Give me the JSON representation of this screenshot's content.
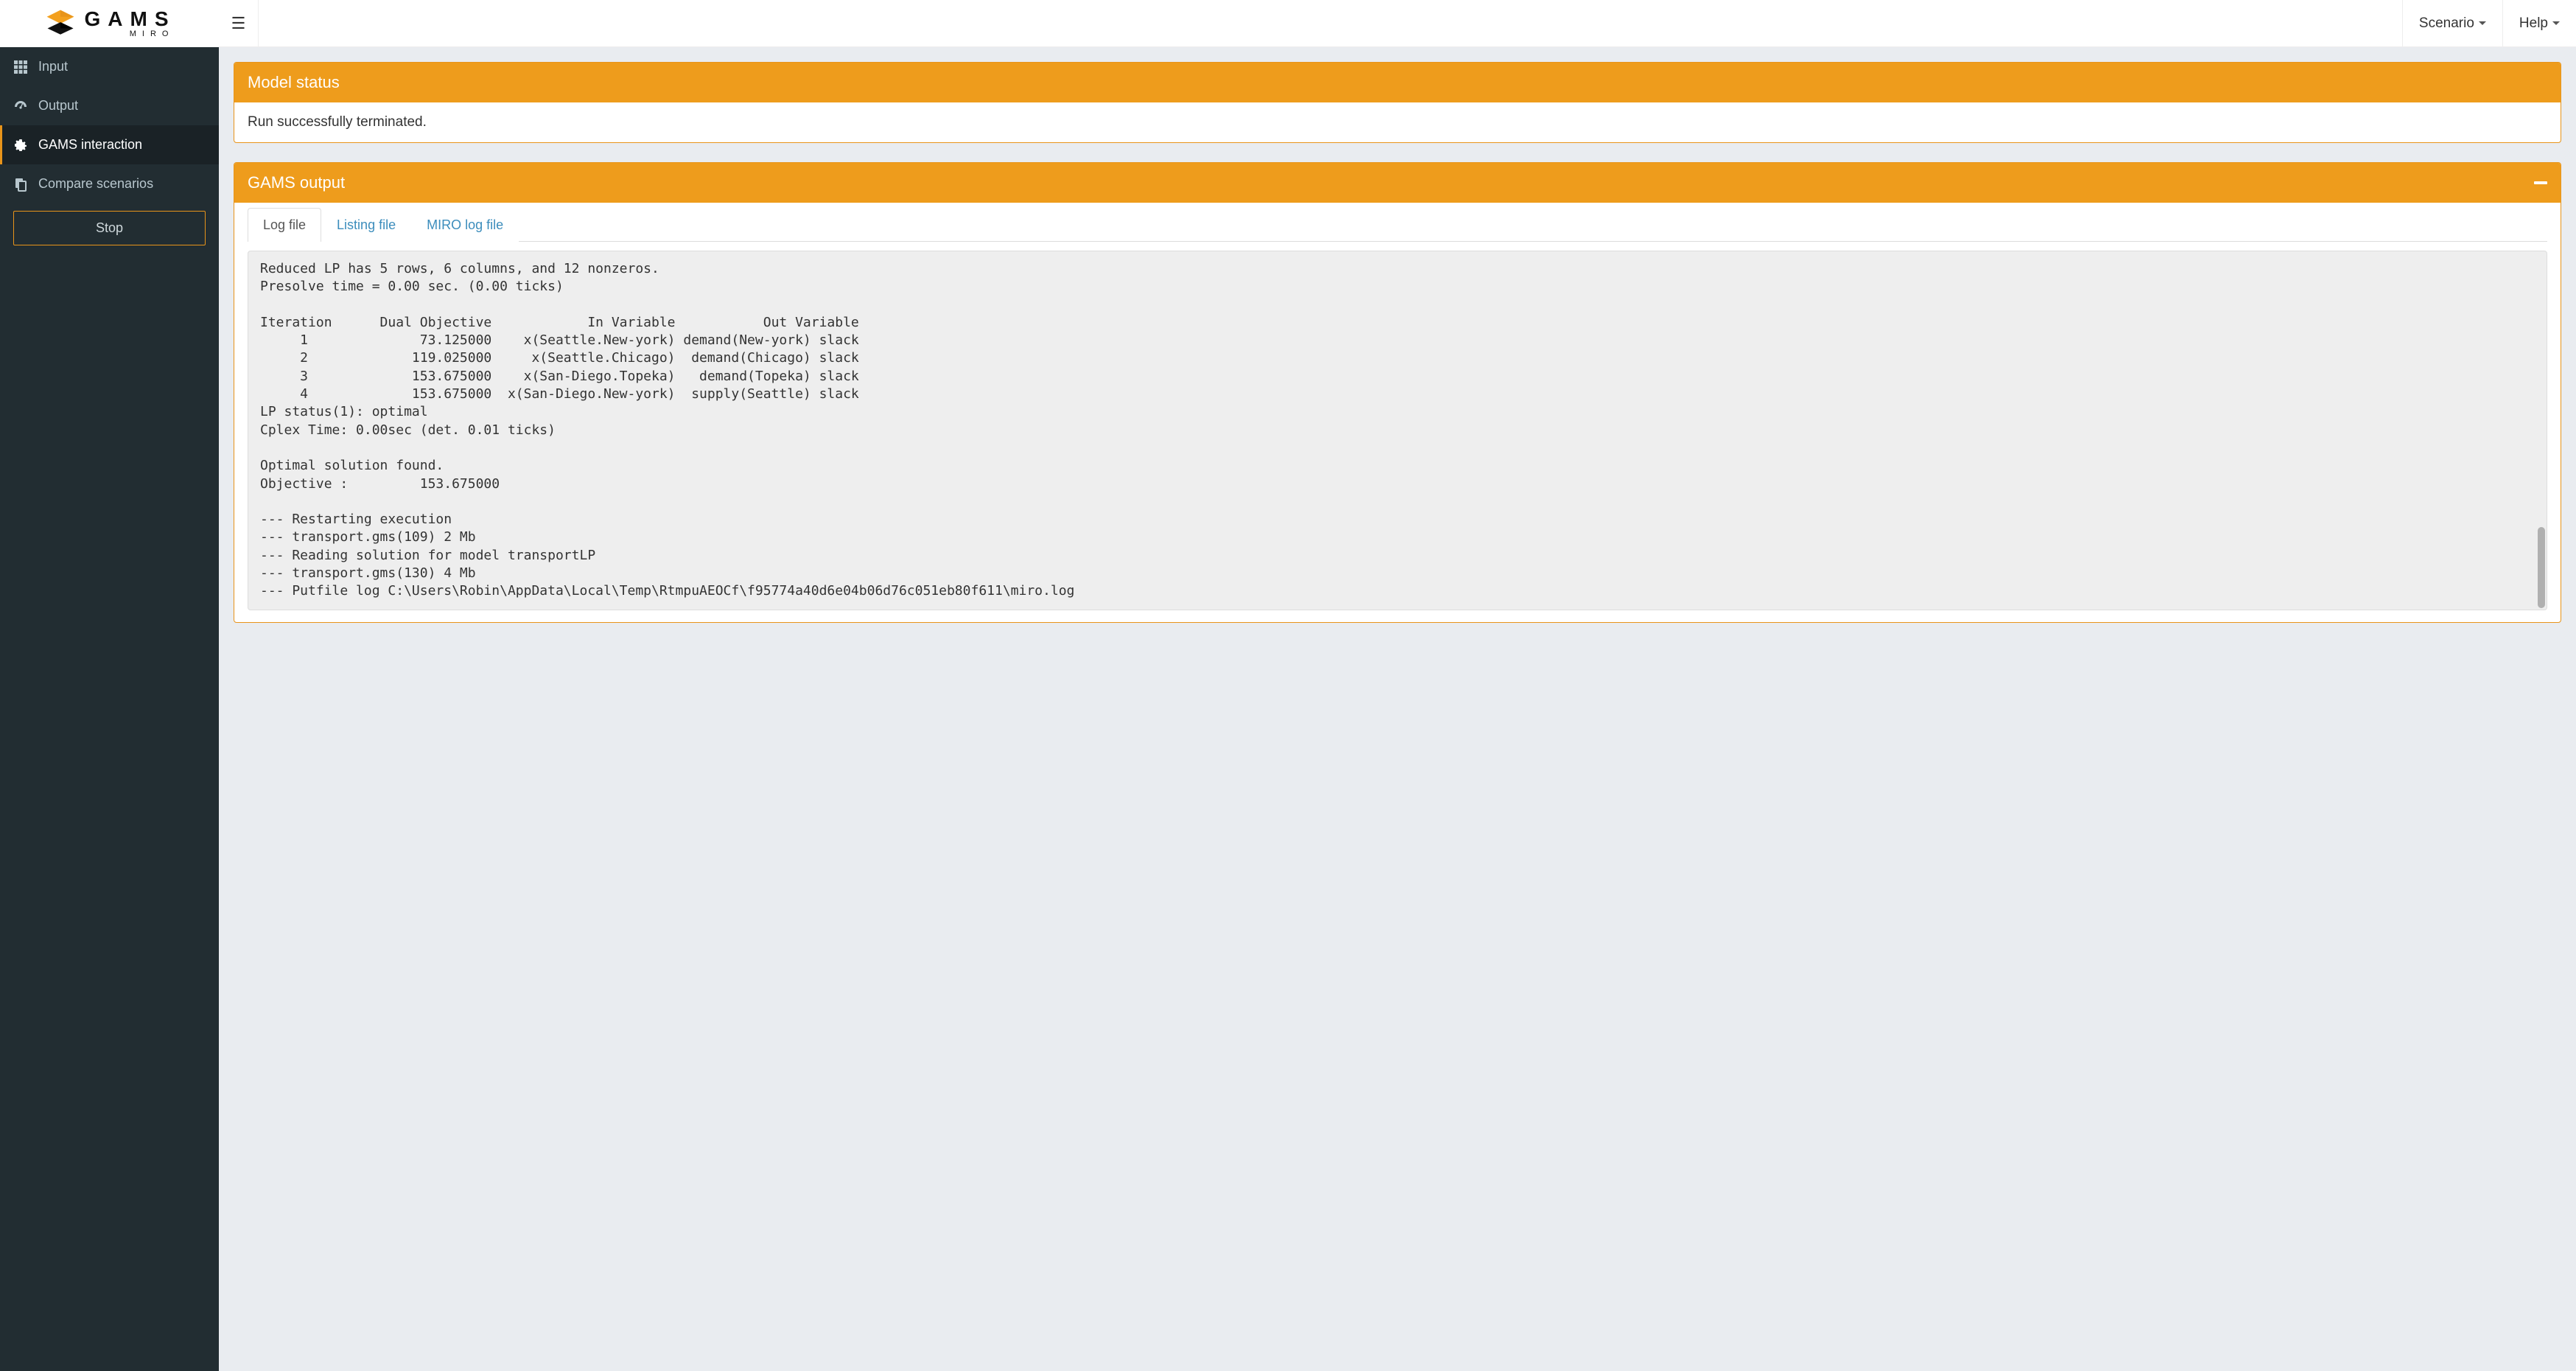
{
  "brand": {
    "wordmark": "GAMS",
    "subline": "MIRO"
  },
  "sidebar": {
    "items": [
      {
        "id": "input",
        "label": "Input",
        "icon": "grid"
      },
      {
        "id": "output",
        "label": "Output",
        "icon": "gauge"
      },
      {
        "id": "interact",
        "label": "GAMS interaction",
        "icon": "gear",
        "active": true
      },
      {
        "id": "compare",
        "label": "Compare scenarios",
        "icon": "copy"
      }
    ],
    "stop_label": "Stop"
  },
  "topbar": {
    "menu": [
      {
        "id": "scenario",
        "label": "Scenario"
      },
      {
        "id": "help",
        "label": "Help"
      }
    ]
  },
  "panels": {
    "model_status": {
      "title": "Model status",
      "text": "Run successfully terminated."
    },
    "gams_output": {
      "title": "GAMS output",
      "tabs": [
        {
          "id": "log",
          "label": "Log file",
          "active": true
        },
        {
          "id": "listing",
          "label": "Listing file"
        },
        {
          "id": "mirolog",
          "label": "MIRO log file"
        }
      ],
      "log_content": "Reduced LP has 5 rows, 6 columns, and 12 nonzeros.\nPresolve time = 0.00 sec. (0.00 ticks)\n\nIteration      Dual Objective            In Variable           Out Variable\n     1              73.125000    x(Seattle.New-york) demand(New-york) slack\n     2             119.025000     x(Seattle.Chicago)  demand(Chicago) slack\n     3             153.675000    x(San-Diego.Topeka)   demand(Topeka) slack\n     4             153.675000  x(San-Diego.New-york)  supply(Seattle) slack\nLP status(1): optimal\nCplex Time: 0.00sec (det. 0.01 ticks)\n\nOptimal solution found.\nObjective :         153.675000\n\n--- Restarting execution\n--- transport.gms(109) 2 Mb\n--- Reading solution for model transportLP\n--- transport.gms(130) 4 Mb\n--- Putfile log C:\\Users\\Robin\\AppData\\Local\\Temp\\RtmpuAEOCf\\f95774a40d6e04b06d76c051eb80f611\\miro.log"
    }
  }
}
